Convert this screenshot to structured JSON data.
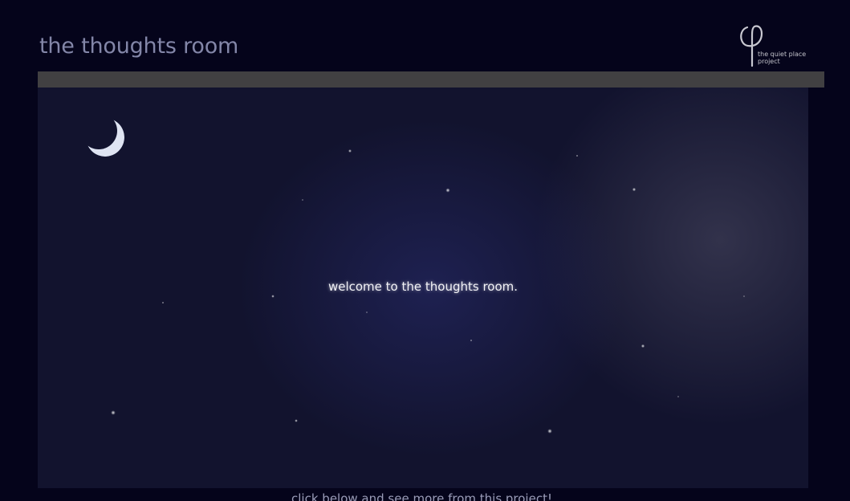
{
  "header": {
    "title": "the thoughts room"
  },
  "logo": {
    "icon": "phi-symbol-icon",
    "line1": "the quiet place",
    "line2": "project"
  },
  "scene": {
    "welcome_text": "welcome to the thoughts room."
  },
  "footer": {
    "link_text": "click below and see more from this project!"
  },
  "colors": {
    "page_background": "#05041b",
    "title": "#8386a8",
    "bar": "#414042",
    "sky": "#12132e"
  }
}
